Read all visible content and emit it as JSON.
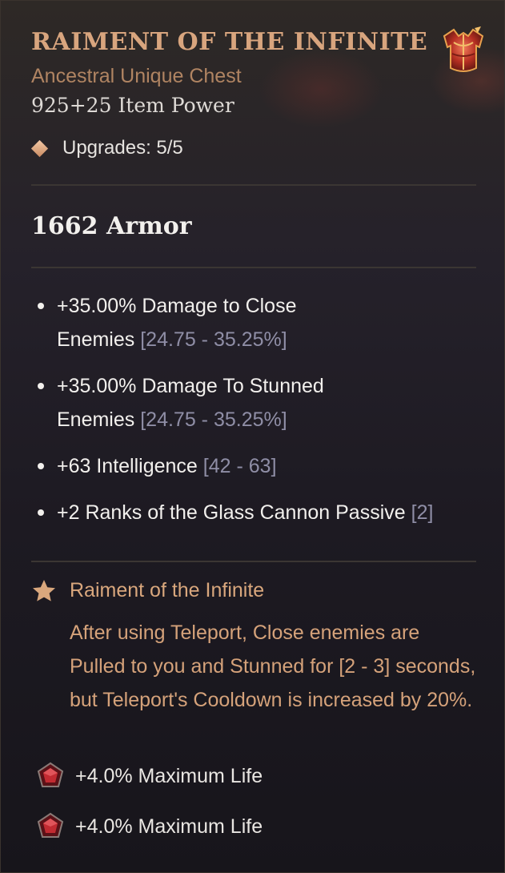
{
  "item": {
    "name": "RAIMENT OF THE INFINITE",
    "type": "Ancestral Unique Chest",
    "item_power": "925+25 Item Power",
    "upgrades": "Upgrades: 5/5",
    "armor": "1662 Armor",
    "icon": "chest-armor-icon"
  },
  "affixes": [
    {
      "text": "+35.00% Damage to Close Enemies",
      "range": "[24.75 - 35.25%]"
    },
    {
      "text": "+35.00% Damage To Stunned Enemies",
      "range": "[24.75 - 35.25%]"
    },
    {
      "text": "+63 Intelligence",
      "range": "[42 - 63]"
    },
    {
      "text": "+2 Ranks of the Glass Cannon Passive",
      "range": "[2]"
    }
  ],
  "unique_power": {
    "name": "Raiment of the Infinite",
    "description": "After using Teleport, Close enemies are Pulled to you and Stunned for [2 - 3] seconds, but Teleport's Cooldown is increased by 20%.",
    "icon": "star-icon"
  },
  "sockets": [
    {
      "text": "+4.0% Maximum Life",
      "icon": "ruby-gem-icon"
    },
    {
      "text": "+4.0% Maximum Life",
      "icon": "ruby-gem-icon"
    }
  ],
  "colors": {
    "title": "#d8a57e",
    "subtitle": "#b08462",
    "range": "#8f8ea6",
    "unique_text": "#d5a27a",
    "background": "#1d1a22"
  }
}
